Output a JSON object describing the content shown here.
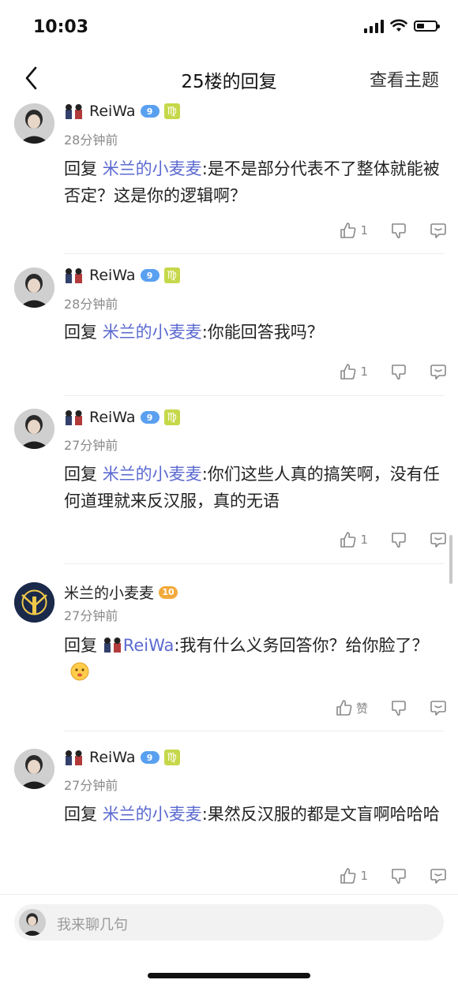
{
  "status_bar": {
    "time": "10:03",
    "battery_level": 0.4
  },
  "nav": {
    "title": "25楼的回复",
    "right": "查看主题"
  },
  "replies": [
    {
      "username": "ReiWa",
      "level": "9",
      "zodiac": "♍",
      "time": "28分钟前",
      "prefix": "回复 ",
      "mention": "米兰的小麦麦",
      "text": ":是不是部分代表不了整体就能被否定？这是你的逻辑啊？",
      "likes": "1"
    },
    {
      "username": "ReiWa",
      "level": "9",
      "zodiac": "♍",
      "time": "28分钟前",
      "prefix": "回复 ",
      "mention": "米兰的小麦麦",
      "text": ":你能回答我吗？",
      "likes": "1"
    },
    {
      "username": "ReiWa",
      "level": "9",
      "zodiac": "♍",
      "time": "27分钟前",
      "prefix": "回复 ",
      "mention": "米兰的小麦麦",
      "text": ":你们这些人真的搞笑啊，没有任何道理就来反汉服，真的无语",
      "likes": "1"
    },
    {
      "username": "米兰的小麦麦",
      "level": "10",
      "time": "27分钟前",
      "prefix": "回复 ",
      "mention": "ReiWa",
      "text": ":我有什么义务回答你？给你脸了？",
      "likes": "赞"
    },
    {
      "username": "ReiWa",
      "level": "9",
      "zodiac": "♍",
      "time": "27分钟前",
      "prefix": "回复 ",
      "mention": "米兰的小麦麦",
      "text": ":果然反汉服的都是文盲啊哈哈哈",
      "likes": "1"
    }
  ],
  "input": {
    "placeholder": "我来聊几句"
  },
  "colors": {
    "mention": "#5b6ad0",
    "level_blue": "#5aa0f0",
    "level_gold": "#f2a93b",
    "zodiac": "#c6d84a"
  }
}
